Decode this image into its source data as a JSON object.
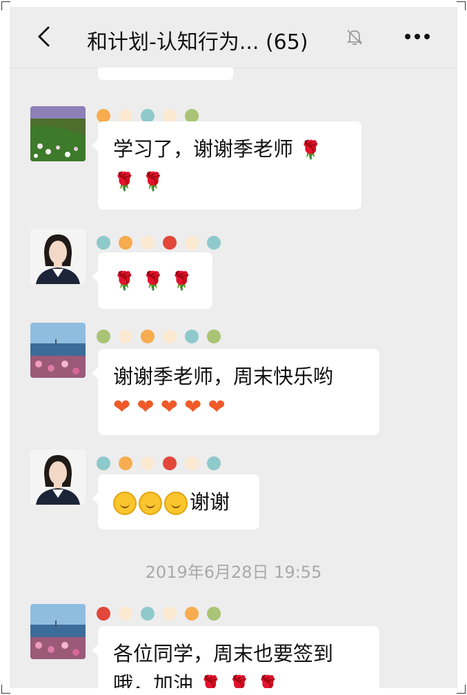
{
  "header": {
    "title": "和计划-认知行为... (65)",
    "back_icon": "chevron-left-icon",
    "mute_icon": "bell-muted-icon",
    "more_icon": "more-dots-icon"
  },
  "messages": [
    {
      "text": "学习了，谢谢季老师",
      "emoji": "🌹"
    },
    {
      "text": "",
      "emoji": "🌹"
    },
    {
      "text": "谢谢季老师，周末快乐哟",
      "emoji": "❤"
    },
    {
      "text": "谢谢",
      "emoji": "😊"
    },
    {
      "text": "各位同学，周末也要签到哦，加油",
      "emoji": "🌹"
    }
  ],
  "timestamp": "2019年6月28日 19:55",
  "colors": {
    "background": "#ededed",
    "bubble": "#ffffff",
    "rose": "#d0262c",
    "heart": "#f05a28"
  }
}
